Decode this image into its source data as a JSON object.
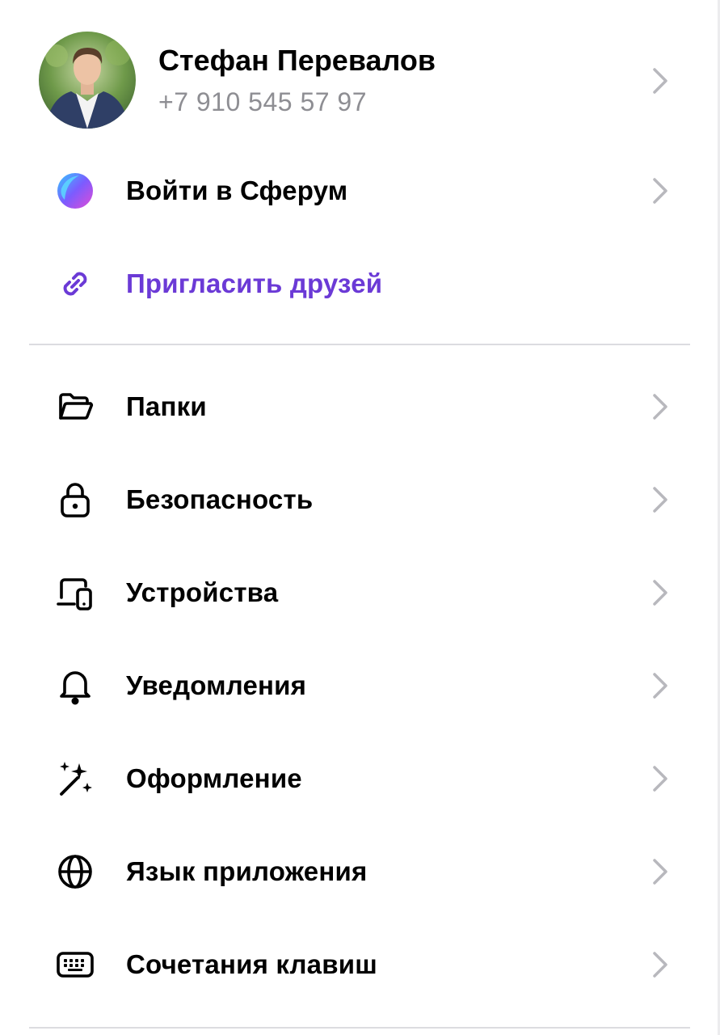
{
  "profile": {
    "name": "Стефан Перевалов",
    "phone": "+7 910 545 57 97",
    "avatar_icon": "user-photo-avatar"
  },
  "actions": {
    "sferum_label": "Войти в Сферум",
    "sferum_icon": "sferum-logo-icon",
    "invite_label": "Пригласить друзей",
    "invite_icon": "link-icon",
    "invite_color": "#6b3ad6"
  },
  "settings": [
    {
      "label": "Папки",
      "icon": "folder-icon"
    },
    {
      "label": "Безопасность",
      "icon": "lock-icon"
    },
    {
      "label": "Устройства",
      "icon": "devices-icon"
    },
    {
      "label": "Уведомления",
      "icon": "bell-icon"
    },
    {
      "label": "Оформление",
      "icon": "magic-wand-icon"
    },
    {
      "label": "Язык приложения",
      "icon": "globe-icon"
    },
    {
      "label": "Сочетания клавиш",
      "icon": "keyboard-icon"
    }
  ],
  "colors": {
    "chevron": "#b8b8bd",
    "secondary_text": "#8e8e93",
    "divider": "#dcdce0"
  }
}
